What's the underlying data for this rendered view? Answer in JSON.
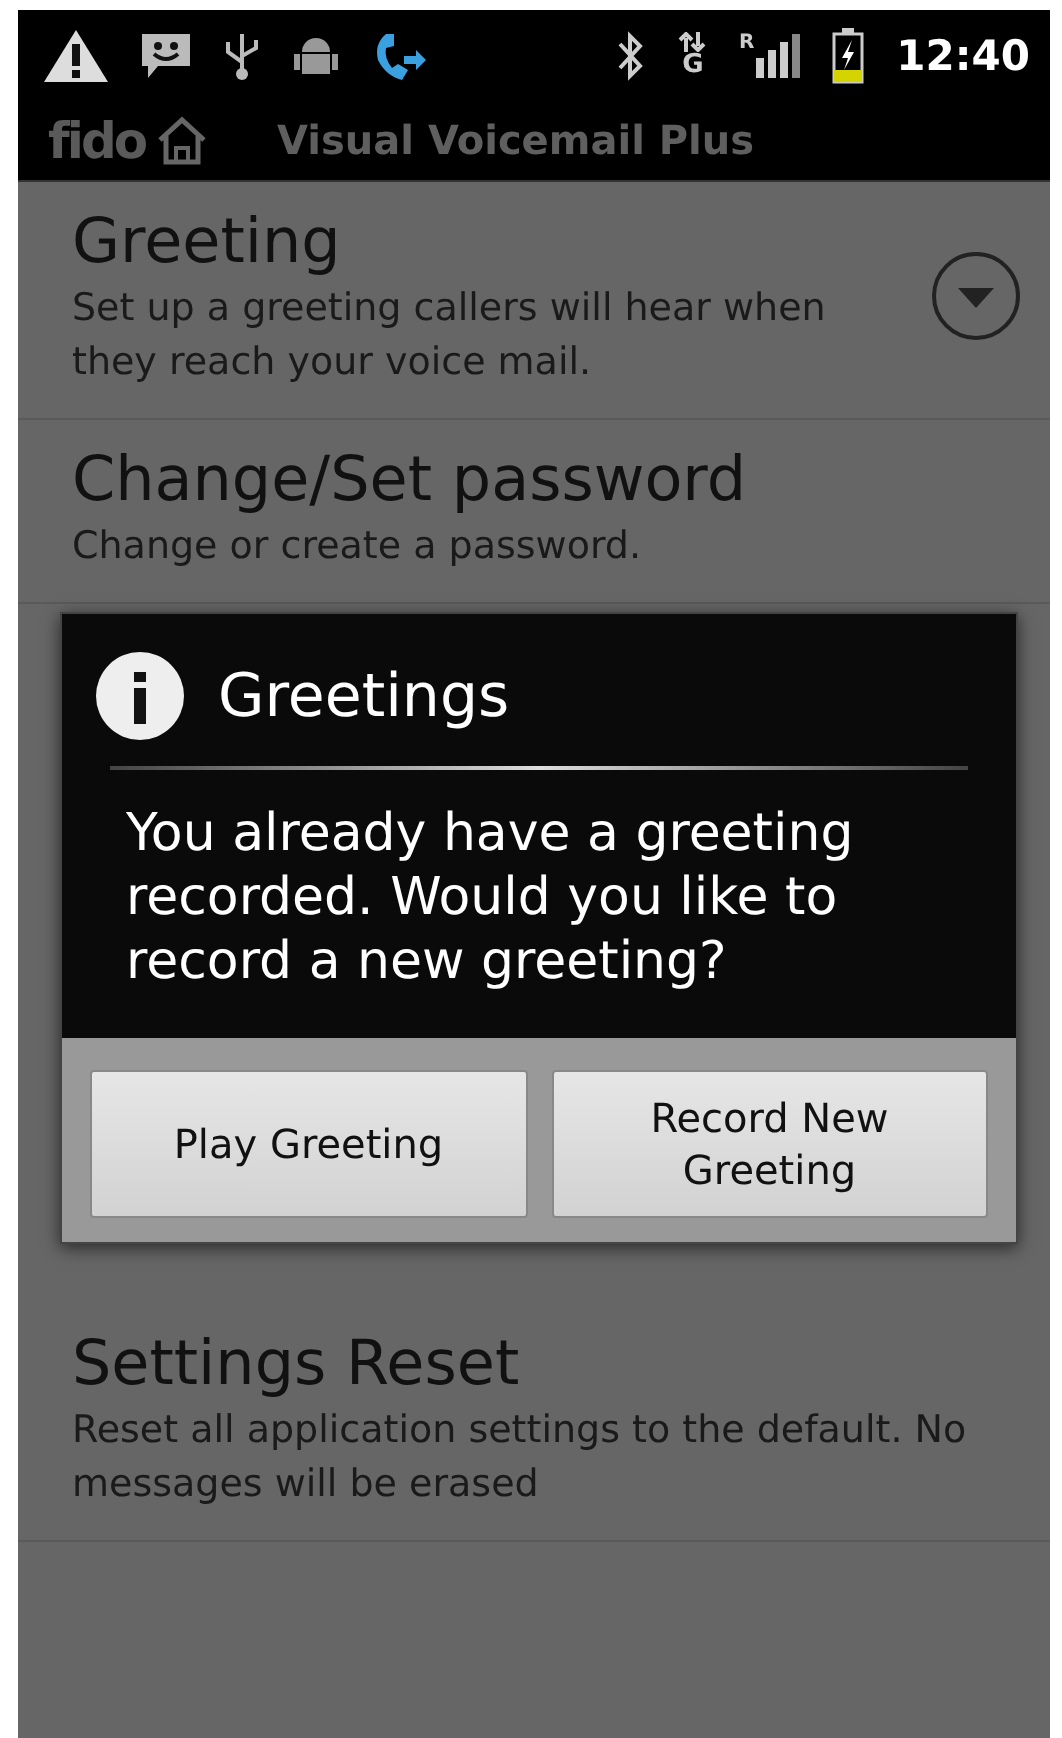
{
  "status_bar": {
    "network_type": "G",
    "roaming_indicator": "R",
    "battery_charging": true,
    "time": "12:40"
  },
  "app_bar": {
    "logo": "fido",
    "title": "Visual Voicemail Plus"
  },
  "settings_items": [
    {
      "kind": "expandable",
      "title": "Greeting",
      "description": "Set up a greeting callers will hear when they reach your voice mail."
    },
    {
      "kind": "plain",
      "title": "Change/Set password",
      "description": "Change or create a password."
    }
  ],
  "dialog": {
    "title": "Greetings",
    "message": "You already have a greeting recorded. Would you like to record a new greeting?",
    "buttons": [
      "Play Greeting",
      "Record New Greeting"
    ]
  },
  "settings_items_below": [
    {
      "title": "Settings Reset",
      "description": "Reset all application settings to the default. No messages will be erased"
    }
  ]
}
